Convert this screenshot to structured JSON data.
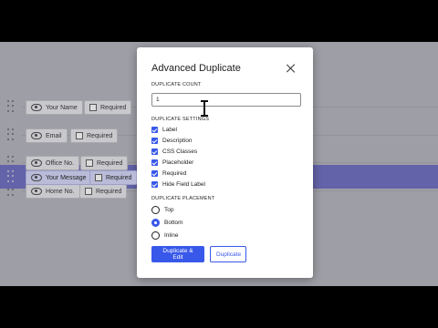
{
  "fields": [
    {
      "name": "Your Name",
      "required_label": "Required"
    },
    {
      "name": "Email",
      "required_label": "Required"
    },
    {
      "name": "Office No.",
      "required_label": "Required"
    },
    {
      "name": "Home No.",
      "required_label": "Required"
    },
    {
      "name": "Your Message",
      "required_label": "Required",
      "selected": true
    }
  ],
  "modal": {
    "title": "Advanced Duplicate",
    "count_label": "DUPLICATE COUNT",
    "count_value": "1",
    "settings_label": "DUPLICATE SETTINGS",
    "settings": [
      {
        "label": "Label",
        "checked": true
      },
      {
        "label": "Description",
        "checked": true
      },
      {
        "label": "CSS Classes",
        "checked": true
      },
      {
        "label": "Placeholder",
        "checked": true
      },
      {
        "label": "Required",
        "checked": true
      },
      {
        "label": "Hide Field Label",
        "checked": true
      }
    ],
    "placement_label": "DUPLICATE PLACEMENT",
    "placement_options": [
      {
        "label": "Top",
        "selected": false
      },
      {
        "label": "Bottom",
        "selected": true
      },
      {
        "label": "Inline",
        "selected": false
      }
    ],
    "primary_button": "Duplicate & Edit",
    "secondary_button": "Duplicate"
  },
  "colors": {
    "accent": "#3858e9",
    "selected_row": "#5c5fc4",
    "backdrop": "#b9b9bf"
  }
}
